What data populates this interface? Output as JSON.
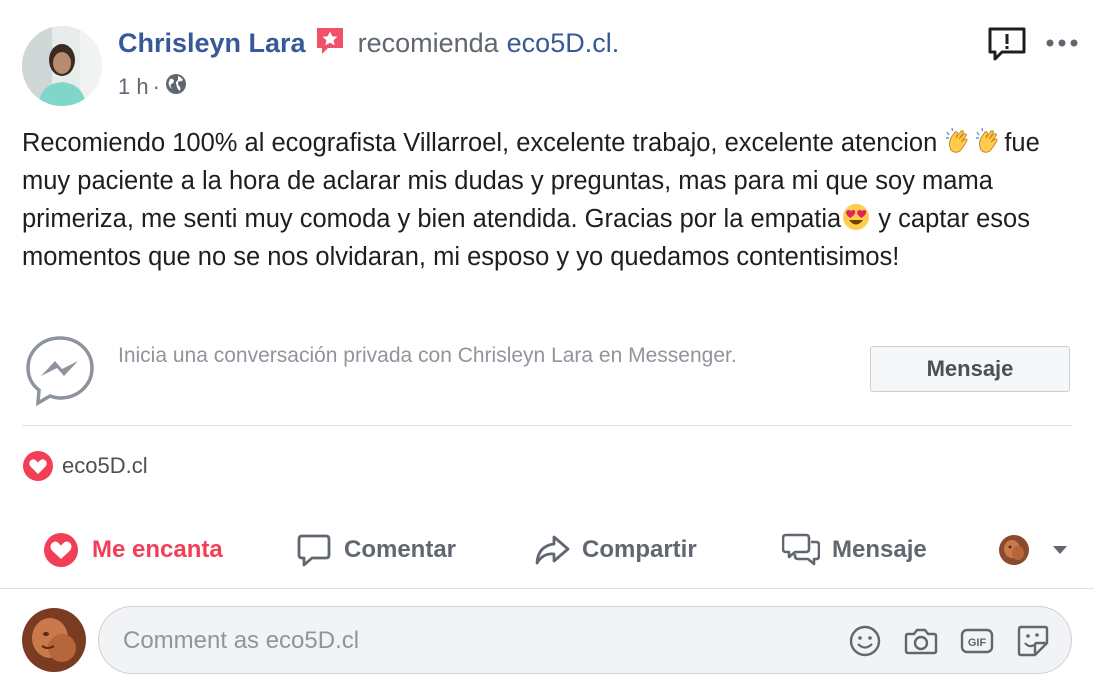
{
  "post": {
    "author_name": "Chrisleyn Lara",
    "verb": "recomienda",
    "page_name": "eco5D.cl.",
    "time": "1 h",
    "meta_separator": "·",
    "text_part1": "Recomiendo 100% al ecografista Villarroel, excelente trabajo, excelente atencion ",
    "text_part2": "fue muy paciente a la hora de aclarar mis dudas y preguntas, mas para mi que soy mama primeriza, me senti muy comoda y bien atendida. Gracias por la empatia",
    "text_part3": " y captar esos momentos que no se nos olvidaran, mi esposo y yo quedamos contentisimos!"
  },
  "messenger": {
    "prompt": "Inicia una conversación privada con Chrisleyn Lara en Messenger.",
    "button_label": "Mensaje"
  },
  "reactions": {
    "reactor": "eco5D.cl",
    "icon": "love-reaction-icon"
  },
  "actions": {
    "love_label": "Me encanta",
    "comment_label": "Comentar",
    "share_label": "Compartir",
    "message_label": "Mensaje"
  },
  "comment": {
    "placeholder": "Comment as eco5D.cl",
    "icons": [
      "emoji-icon",
      "camera-icon",
      "gif-icon",
      "sticker-icon"
    ]
  },
  "colors": {
    "link_blue": "#385898",
    "love_red": "#f33e58",
    "muted_gray": "#606770"
  }
}
